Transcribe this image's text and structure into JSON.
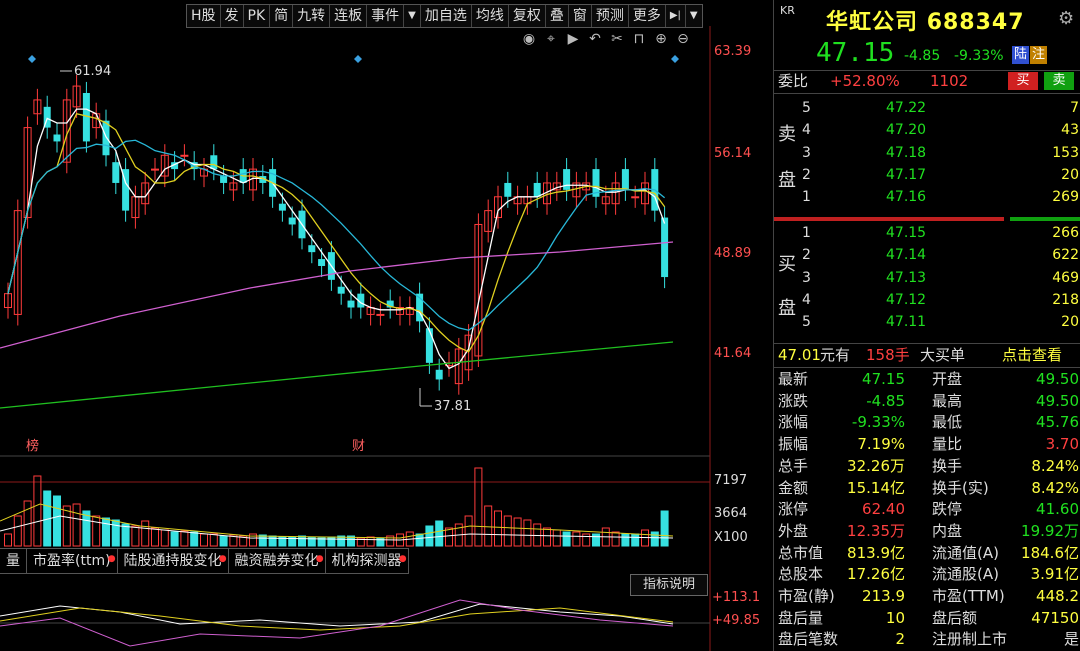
{
  "toolbar": {
    "buttons": [
      "H股",
      "发",
      "PK",
      "简",
      "九转",
      "连板",
      "事件",
      "加自选",
      "均线",
      "复权",
      "叠",
      "窗",
      "预测",
      "更多"
    ]
  },
  "chart": {
    "price_axis": [
      "63.39",
      "56.14",
      "48.89",
      "41.64"
    ],
    "high_marker": "61.94",
    "low_marker": "37.81",
    "event_markers": [
      "榜",
      "财"
    ],
    "volume_axis": [
      "7197",
      "3664",
      "X100"
    ],
    "indicator_axis": [
      "+113.1",
      "+49.85"
    ],
    "indicator_button": "指标说明",
    "colors": {
      "up": "#ff3b3b",
      "down": "#36e0e0",
      "ma5": "#ffffff",
      "ma10": "#e0d020",
      "ma20": "#28b8d8",
      "ma60": "#d060d0",
      "ma120": "#20c020"
    }
  },
  "bottom_tabs": [
    "量",
    "市盈率(ttm)",
    "陆股通持股变化",
    "融资融券变化",
    "机构探测器"
  ],
  "stock": {
    "badge": "KR",
    "name": "华虹公司",
    "code": "688347",
    "price": "47.15",
    "change": "-4.85",
    "change_pct": "-9.33%",
    "tag1": "陆",
    "tag2": "注"
  },
  "weibi": {
    "label": "委比",
    "ratio": "+52.80%",
    "diff": "1102",
    "buy": "买",
    "sell": "卖"
  },
  "order_book": {
    "sell_label": "卖盘",
    "buy_label": "买盘",
    "asks": [
      {
        "lvl": "5",
        "price": "47.22",
        "vol": "7"
      },
      {
        "lvl": "4",
        "price": "47.20",
        "vol": "43"
      },
      {
        "lvl": "3",
        "price": "47.18",
        "vol": "153"
      },
      {
        "lvl": "2",
        "price": "47.17",
        "vol": "20"
      },
      {
        "lvl": "1",
        "price": "47.16",
        "vol": "269"
      }
    ],
    "bids": [
      {
        "lvl": "1",
        "price": "47.15",
        "vol": "266"
      },
      {
        "lvl": "2",
        "price": "47.14",
        "vol": "622"
      },
      {
        "lvl": "3",
        "price": "47.13",
        "vol": "469"
      },
      {
        "lvl": "4",
        "price": "47.12",
        "vol": "218"
      },
      {
        "lvl": "5",
        "price": "47.11",
        "vol": "20"
      }
    ]
  },
  "big_order": {
    "price": "47.01",
    "text1": "元有",
    "qty": "158手",
    "text2": "大买单",
    "link": "点击查看"
  },
  "stats": [
    {
      "l1": "最新",
      "v1": "47.15",
      "c1": "green",
      "l2": "开盘",
      "v2": "49.50",
      "c2": "green"
    },
    {
      "l1": "涨跌",
      "v1": "-4.85",
      "c1": "green",
      "l2": "最高",
      "v2": "49.50",
      "c2": "green"
    },
    {
      "l1": "涨幅",
      "v1": "-9.33%",
      "c1": "green",
      "l2": "最低",
      "v2": "45.76",
      "c2": "green"
    },
    {
      "l1": "振幅",
      "v1": "7.19%",
      "c1": "yellow",
      "l2": "量比",
      "v2": "3.70",
      "c2": "red"
    },
    {
      "l1": "总手",
      "v1": "32.26万",
      "c1": "yellow",
      "l2": "换手",
      "v2": "8.24%",
      "c2": "yellow"
    },
    {
      "l1": "金额",
      "v1": "15.14亿",
      "c1": "yellow",
      "l2": "换手(实)",
      "v2": "8.42%",
      "c2": "yellow"
    },
    {
      "l1": "涨停",
      "v1": "62.40",
      "c1": "red",
      "l2": "跌停",
      "v2": "41.60",
      "c2": "green"
    },
    {
      "l1": "外盘",
      "v1": "12.35万",
      "c1": "red",
      "l2": "内盘",
      "v2": "19.92万",
      "c2": "green"
    },
    {
      "l1": "总市值",
      "v1": "813.9亿",
      "c1": "yellow",
      "l2": "流通值(A)",
      "v2": "184.6亿",
      "c2": "yellow"
    },
    {
      "l1": "总股本",
      "v1": "17.26亿",
      "c1": "yellow",
      "l2": "流通股(A)",
      "v2": "3.91亿",
      "c2": "yellow"
    },
    {
      "l1": "市盈(静)",
      "v1": "213.9",
      "c1": "yellow",
      "l2": "市盈(TTM)",
      "v2": "448.2",
      "c2": "yellow"
    },
    {
      "l1": "盘后量",
      "v1": "10",
      "c1": "yellow",
      "l2": "盘后额",
      "v2": "47150",
      "c2": "yellow"
    },
    {
      "l1": "盘后笔数",
      "v1": "2",
      "c1": "yellow",
      "l2": "注册制上市",
      "v2": "是",
      "c2": "white"
    }
  ]
}
